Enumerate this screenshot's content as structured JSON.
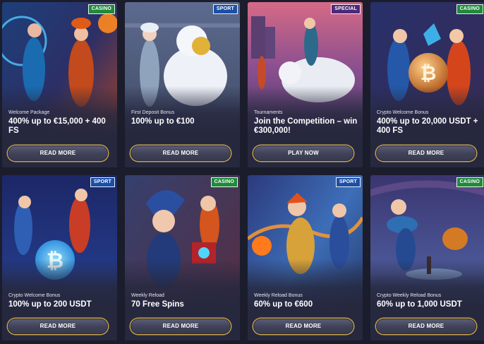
{
  "colors": {
    "background": "#1b1d2c",
    "card_bottom": "#26283e",
    "casino_badge": "#1f8a3a",
    "sport_badge": "#1b4fa6",
    "special_badge": "#4c2a7a",
    "button_border": "#c8a24a"
  },
  "cards": [
    {
      "badge": "CASINO",
      "subtitle": "Welcome Package",
      "title": "400% up to €15,000 + 400 FS",
      "button": "READ MORE",
      "art": "mage-couple-fire-ice"
    },
    {
      "badge": "SPORT",
      "subtitle": "First Deposit Bonus",
      "title": "100% up to €100",
      "button": "READ MORE",
      "art": "girl-with-snowman"
    },
    {
      "badge": "SPECIAL",
      "subtitle": "Tournaments",
      "title": "Join the Competition – win €300,000!",
      "button": "PLAY NOW",
      "art": "polar-bear-rider"
    },
    {
      "badge": "CASINO",
      "subtitle": "Crypto Welcome Bonus",
      "title": "400% up to 20,000 USDT + 400 FS",
      "button": "READ MORE",
      "art": "bitcoin-coin-duo"
    },
    {
      "badge": "SPORT",
      "subtitle": "Crypto Welcome Bonus",
      "title": "100% up to 200 USDT",
      "button": "READ MORE",
      "art": "hockey-bitcoin"
    },
    {
      "badge": "CASINO",
      "subtitle": "Weekly Reload",
      "title": "70 Free Spins",
      "button": "READ MORE",
      "art": "jester-gift-box"
    },
    {
      "badge": "SPORT",
      "subtitle": "Weekly Reload Bonus",
      "title": "60% up to €600",
      "button": "READ MORE",
      "art": "fire-hockey-player"
    },
    {
      "badge": "CASINO",
      "subtitle": "Crypto Weekly Reload Bonus",
      "title": "60% up to 1,000 USDT",
      "button": "READ MORE",
      "art": "ice-curling-duo"
    }
  ]
}
